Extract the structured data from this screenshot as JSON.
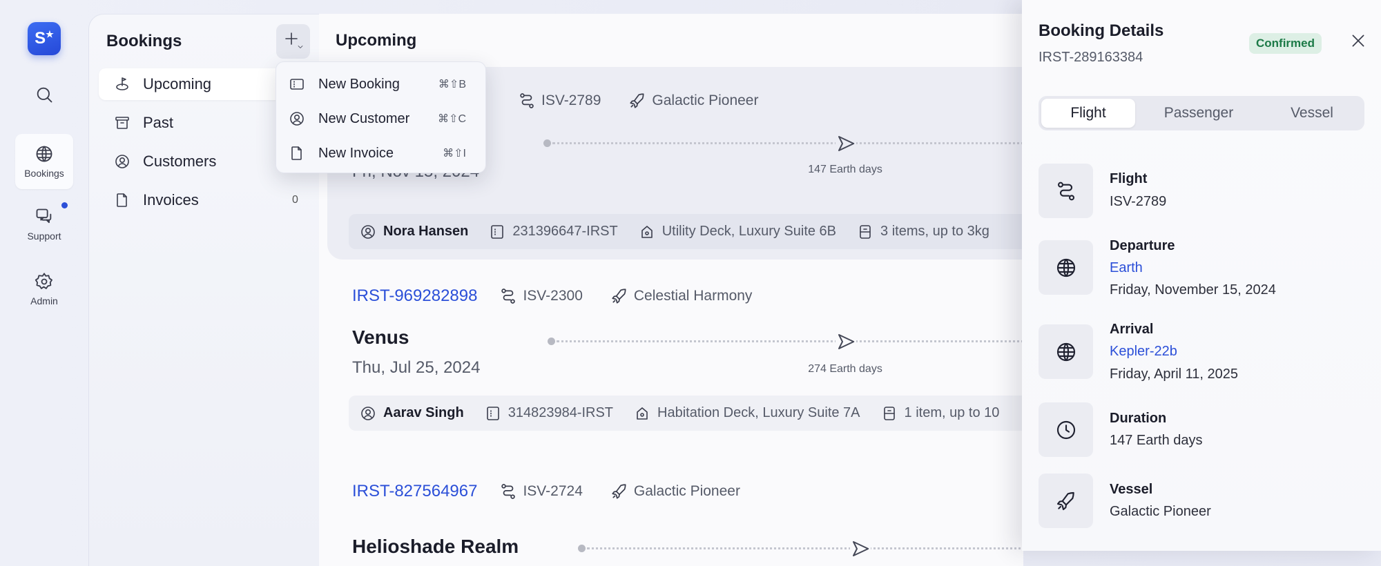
{
  "rail": {
    "logo_text": "S",
    "items": [
      {
        "icon": "search-icon",
        "label": ""
      },
      {
        "icon": "globe-icon",
        "label": "Bookings",
        "active": true
      },
      {
        "icon": "chat-icon",
        "label": "Support",
        "badge_color": "#2b4fd8"
      },
      {
        "icon": "gear-icon",
        "label": "Admin"
      }
    ]
  },
  "sidebar": {
    "title": "Bookings",
    "items": [
      {
        "icon": "upcoming-icon",
        "label": "Upcoming",
        "active": true
      },
      {
        "icon": "archive-icon",
        "label": "Past"
      },
      {
        "icon": "user-circle-icon",
        "label": "Customers"
      },
      {
        "icon": "document-icon",
        "label": "Invoices",
        "count": "0"
      }
    ]
  },
  "new_menu": {
    "items": [
      {
        "icon": "booking-icon",
        "label": "New Booking",
        "shortcut": "⌘⇧B"
      },
      {
        "icon": "user-circle-icon",
        "label": "New Customer",
        "shortcut": "⌘⇧C"
      },
      {
        "icon": "document-icon",
        "label": "New Invoice",
        "shortcut": "⌘⇧I"
      }
    ]
  },
  "main": {
    "title": "Upcoming",
    "bookings": [
      {
        "id": "",
        "flight": "ISV-2789",
        "vessel": "Galactic Pioneer",
        "destination": "",
        "date": "Fri, Nov 15, 2024",
        "duration": "147 Earth days",
        "passenger": "Nora Hansen",
        "passenger_id": "231396647-IRST",
        "cabin": "Utility Deck, Luxury Suite 6B",
        "luggage": "3 items, up to 3kg",
        "selected": true
      },
      {
        "id": "IRST-969282898",
        "flight": "ISV-2300",
        "vessel": "Celestial Harmony",
        "destination": "Venus",
        "date": "Thu, Jul 25, 2024",
        "duration": "274 Earth days",
        "passenger": "Aarav Singh",
        "passenger_id": "314823984-IRST",
        "cabin": "Habitation Deck, Luxury Suite 7A",
        "luggage": "1 item, up to 10"
      },
      {
        "id": "IRST-827564967",
        "flight": "ISV-2724",
        "vessel": "Galactic Pioneer",
        "destination": "Helioshade Realm"
      }
    ]
  },
  "detail": {
    "title": "Booking Details",
    "booking_id": "IRST-289163384",
    "status": "Confirmed",
    "status_color": "#1c7a47",
    "tabs": [
      "Flight",
      "Passenger",
      "Vessel"
    ],
    "active_tab": "Flight",
    "fields": [
      {
        "icon": "route-icon",
        "label": "Flight",
        "value": "ISV-2789"
      },
      {
        "icon": "globe-icon",
        "label": "Departure",
        "link": "Earth",
        "value": "Friday, November 15, 2024"
      },
      {
        "icon": "globe-icon",
        "label": "Arrival",
        "link": "Kepler-22b",
        "value": "Friday, April 11, 2025"
      },
      {
        "icon": "clock-icon",
        "label": "Duration",
        "value": "147 Earth days"
      },
      {
        "icon": "rocket-icon",
        "label": "Vessel",
        "value": "Galactic Pioneer"
      }
    ]
  },
  "accent_color": "#2b4fd8"
}
